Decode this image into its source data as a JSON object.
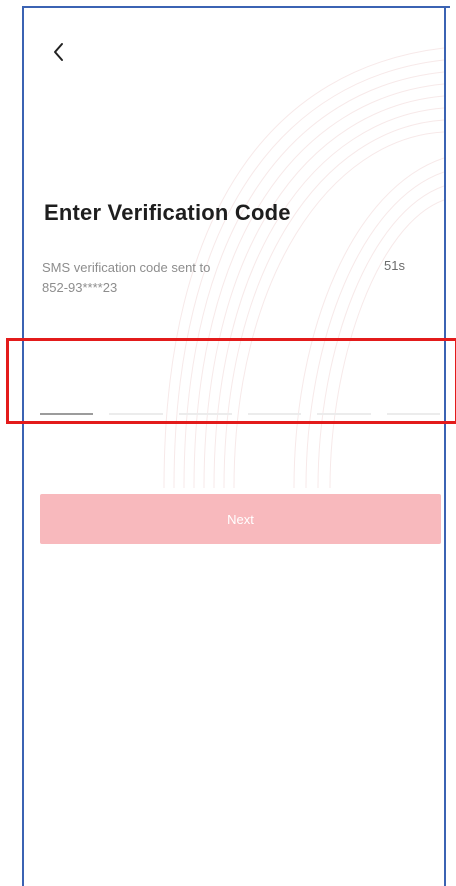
{
  "screen": {
    "title": "Enter Verification Code",
    "subtitle_line1": "SMS verification code sent to",
    "subtitle_line2": "852-93****23",
    "countdown": "51s"
  },
  "code_input": {
    "digits": 6,
    "active_index": 0
  },
  "actions": {
    "back_icon": "chevron-left-icon",
    "next_label": "Next"
  },
  "colors": {
    "accent_disabled": "#f8b9bd",
    "highlight_box": "#e31b1b",
    "frame_border": "#3b63b3"
  }
}
